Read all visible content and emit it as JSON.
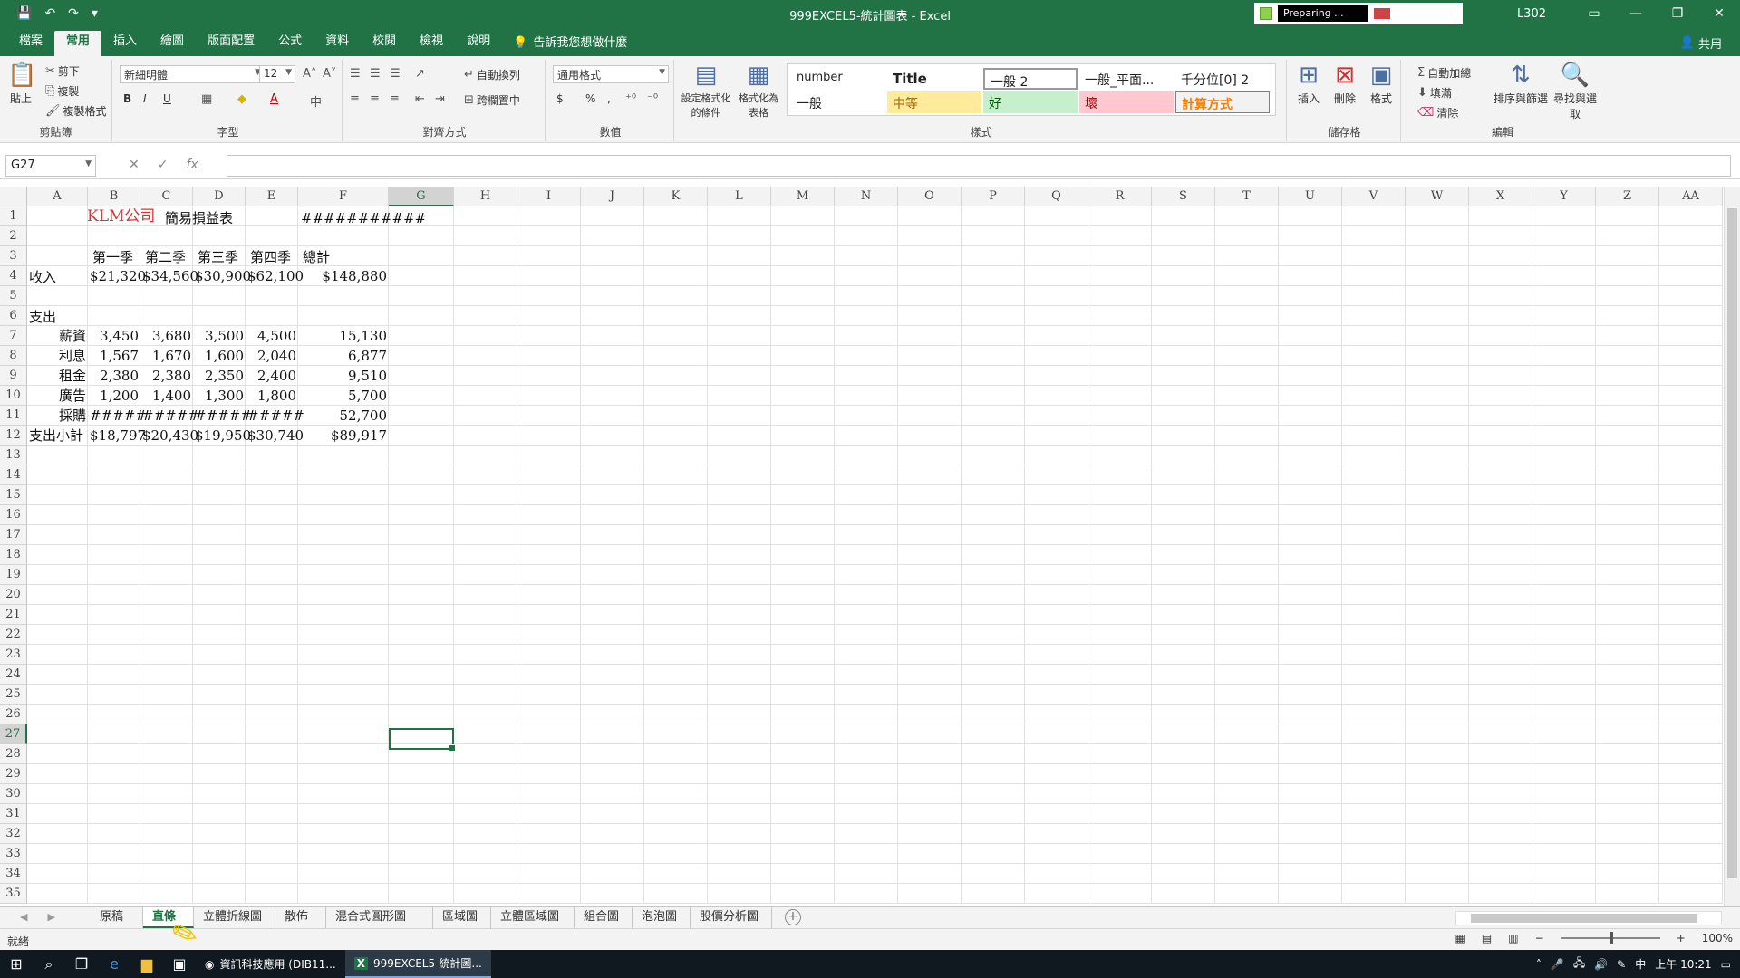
{
  "app": {
    "title": "999EXCEL5-統計圖表 - Excel",
    "user_code": "L302",
    "preparing_text": "Preparing ..."
  },
  "ribbon_tabs": [
    "檔案",
    "常用",
    "插入",
    "繪圖",
    "版面配置",
    "公式",
    "資料",
    "校閱",
    "檢視",
    "說明"
  ],
  "tell_me": "告訴我您想做什麼",
  "share": "共用",
  "ribbon": {
    "clipboard": {
      "cut": "剪下",
      "copy": "複製",
      "paste_format": "複製格式",
      "paste": "貼上",
      "label": "剪貼簿"
    },
    "font": {
      "name": "新細明體",
      "size": "12",
      "label": "字型",
      "bold": "B",
      "italic": "I",
      "underline": "U"
    },
    "alignment": {
      "wrap": "自動換列",
      "merge": "跨欄置中",
      "label": "對齊方式"
    },
    "number": {
      "format": "通用格式",
      "label": "數值",
      "currency": "$",
      "percent": "%",
      "comma": ","
    },
    "styles": {
      "conditional": "設定格式化的條件",
      "table": "格式化為表格",
      "label": "樣式",
      "cells": [
        "number",
        "Title",
        "一般 2",
        "一般_平面...",
        "千分位[0] 2",
        "一般",
        "中等",
        "好",
        "壞",
        "計算方式"
      ]
    },
    "cells": {
      "insert": "插入",
      "delete": "刪除",
      "format": "格式",
      "label": "儲存格"
    },
    "editing": {
      "autosum": "自動加總",
      "fill": "填滿",
      "clear": "清除",
      "sort": "排序與篩選",
      "find": "尋找與選取",
      "label": "編輯"
    }
  },
  "formula_bar": {
    "name_box": "G27",
    "formula": ""
  },
  "columns": [
    "A",
    "B",
    "C",
    "D",
    "E",
    "F",
    "G",
    "H",
    "I",
    "J",
    "K",
    "L",
    "M",
    "N",
    "O",
    "P",
    "Q",
    "R",
    "S",
    "T",
    "U",
    "V",
    "W",
    "X",
    "Y",
    "Z",
    "AA"
  ],
  "rows": [
    "1",
    "2",
    "3",
    "4",
    "5",
    "6",
    "7",
    "8",
    "9",
    "10",
    "11",
    "12",
    "13",
    "14",
    "15",
    "16",
    "17",
    "18",
    "19",
    "20",
    "21",
    "22",
    "23",
    "24",
    "25",
    "26",
    "27",
    "28",
    "29",
    "30",
    "31",
    "32",
    "33",
    "34",
    "35"
  ],
  "sheet": {
    "title_company": "KLM公司",
    "title_rest": "簡易損益表",
    "date_overflow": "###########",
    "headers": [
      "第一季",
      "第二季",
      "第三季",
      "第四季",
      "總計"
    ],
    "revenue": {
      "label": "收入",
      "values": [
        "$21,320",
        "$34,560",
        "$30,900",
        "$62,100",
        "$148,880"
      ]
    },
    "expense_label": "支出",
    "expense_rows": [
      {
        "label": "薪資",
        "values": [
          "3,450",
          "3,680",
          "3,500",
          "4,500",
          "15,130"
        ]
      },
      {
        "label": "利息",
        "values": [
          "1,567",
          "1,670",
          "1,600",
          "2,040",
          "6,877"
        ]
      },
      {
        "label": "租金",
        "values": [
          "2,380",
          "2,380",
          "2,350",
          "2,400",
          "9,510"
        ]
      },
      {
        "label": "廣告",
        "values": [
          "1,200",
          "1,400",
          "1,300",
          "1,800",
          "5,700"
        ]
      },
      {
        "label": "採購",
        "values": [
          "#####",
          "#####",
          "#####",
          "#####",
          "52,700"
        ]
      }
    ],
    "subtotal": {
      "label": "支出小計",
      "values": [
        "$18,797",
        "$20,430",
        "$19,950",
        "$30,740",
        "$89,917"
      ]
    }
  },
  "sheet_tabs": [
    "原稿",
    "直條圖",
    "立體折線圖",
    "散佈圖",
    "混合式圓形圖",
    "區域圖",
    "立體區域圖",
    "組合圖",
    "泡泡圖",
    "股價分析圖"
  ],
  "active_sheet": "直條圖",
  "status": {
    "ready": "就緒",
    "zoom": "100%"
  },
  "taskbar": {
    "apps": [
      "資訊科技應用 (DIB11...",
      "999EXCEL5-統計圖..."
    ],
    "ime": "中",
    "clock": "上午 10:21"
  },
  "colors": {
    "excel_green": "#217346",
    "neutral_fill": "#ffeb9c",
    "good_fill": "#c6efce",
    "bad_fill": "#ffc7ce",
    "calc_text": "#fa7d00"
  }
}
